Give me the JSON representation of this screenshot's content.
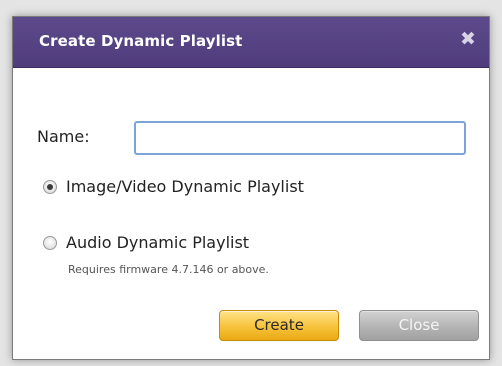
{
  "dialog": {
    "title": "Create Dynamic Playlist",
    "close_glyph": "✖",
    "name_label": "Name:",
    "name_value": "",
    "options": [
      {
        "label": "Image/Video Dynamic Playlist",
        "checked": true
      },
      {
        "label": "Audio Dynamic Playlist",
        "checked": false
      }
    ],
    "audio_note": "Requires firmware 4.7.146 or above.",
    "create_label": "Create",
    "close_label": "Close"
  },
  "colors": {
    "titlebar": "#533f80",
    "create_button": "#f7c23b",
    "close_button": "#b4b4b4",
    "input_border": "#7ea3d8"
  }
}
